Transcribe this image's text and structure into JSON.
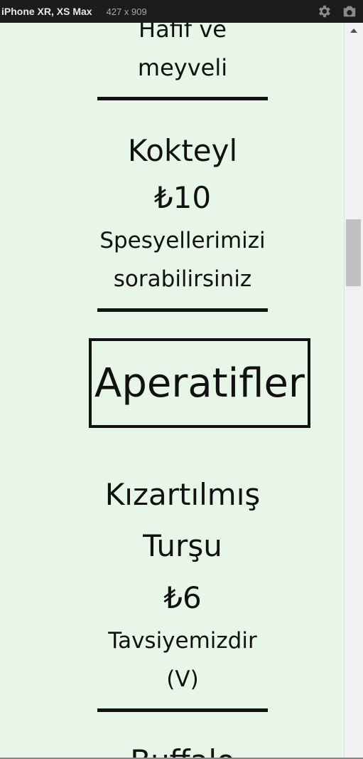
{
  "devtools": {
    "device": "iPhone XR, XS Max",
    "dimensions": "427 x 909",
    "icons": [
      "gear-icon",
      "camera-icon"
    ]
  },
  "menu": {
    "items_before": [
      {
        "name": "",
        "price": "",
        "desc": "Hafif ve meyveli"
      },
      {
        "name": "Kokteyl",
        "price": "₺10",
        "desc": "Spesyellerimizi sorabilirsiniz"
      }
    ],
    "section_title": "Aperatifler",
    "items_after": [
      {
        "name": "Kızartılmış Turşu",
        "price": "₺6",
        "desc": "Tavsiyemizdir (V)"
      },
      {
        "name": "Buffalo",
        "price": "",
        "desc": ""
      }
    ]
  },
  "colors": {
    "background": "#e8f6e8",
    "text": "#111111",
    "devbar": "#1c1c1c"
  }
}
